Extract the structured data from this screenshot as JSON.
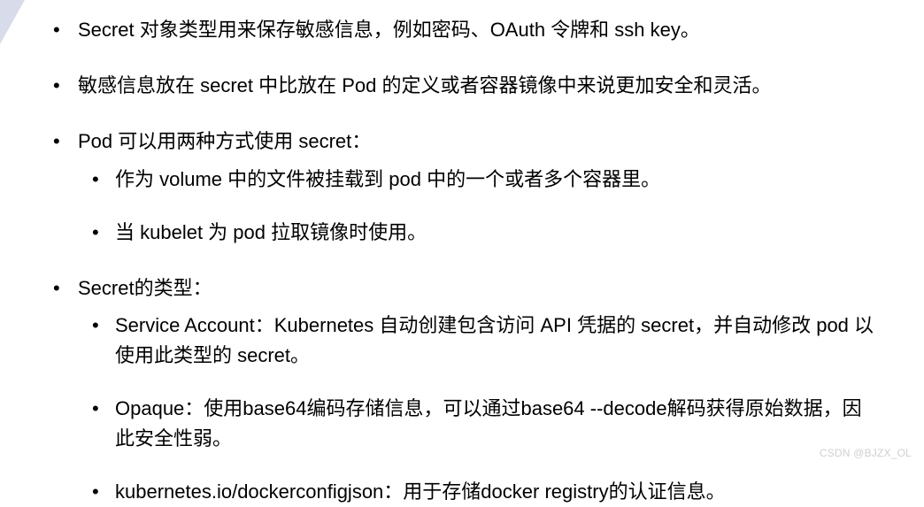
{
  "bullets": [
    {
      "text": "Secret 对象类型用来保存敏感信息，例如密码、OAuth 令牌和 ssh key。"
    },
    {
      "text": "敏感信息放在 secret 中比放在 Pod 的定义或者容器镜像中来说更加安全和灵活。"
    },
    {
      "text": "Pod 可以用两种方式使用 secret：",
      "children": [
        "作为 volume 中的文件被挂载到 pod 中的一个或者多个容器里。",
        "当 kubelet 为 pod 拉取镜像时使用。"
      ]
    },
    {
      "text": "Secret的类型：",
      "children": [
        "Service Account：Kubernetes 自动创建包含访问 API 凭据的 secret，并自动修改 pod 以使用此类型的 secret。",
        "Opaque：使用base64编码存储信息，可以通过base64 --decode解码获得原始数据，因此安全性弱。",
        "kubernetes.io/dockerconfigjson：用于存储docker registry的认证信息。"
      ]
    }
  ],
  "watermark": "CSDN @BJZX_OL"
}
